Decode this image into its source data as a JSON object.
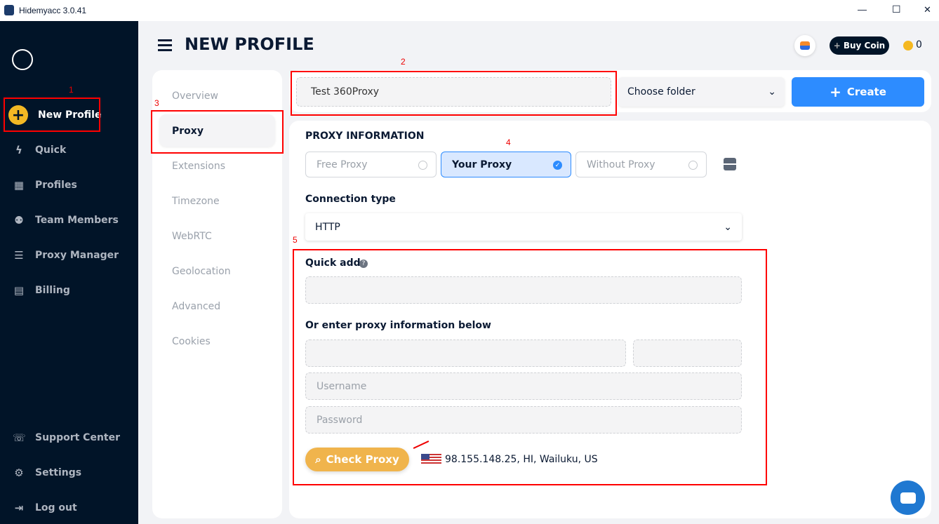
{
  "window": {
    "title": "Hidemyacc 3.0.41",
    "minimize": "—",
    "maximize": "☐",
    "close": "✕"
  },
  "sidebar": {
    "items": [
      {
        "label": "New Profile",
        "icon": "plus-circle-icon"
      },
      {
        "label": "Quick",
        "icon": "bolt-icon"
      },
      {
        "label": "Profiles",
        "icon": "grid-icon"
      },
      {
        "label": "Team Members",
        "icon": "team-icon"
      },
      {
        "label": "Proxy Manager",
        "icon": "server-icon"
      },
      {
        "label": "Billing",
        "icon": "receipt-icon"
      }
    ],
    "bottom": [
      {
        "label": "Support Center",
        "icon": "support-icon"
      },
      {
        "label": "Settings",
        "icon": "gear-icon"
      },
      {
        "label": "Log out",
        "icon": "logout-icon"
      }
    ]
  },
  "header": {
    "title": "NEW PROFILE",
    "buy_coin": "Buy Coin",
    "coin_count": "0"
  },
  "tabs": [
    "Overview",
    "Proxy",
    "Extensions",
    "Timezone",
    "WebRTC",
    "Geolocation",
    "Advanced",
    "Cookies"
  ],
  "profile": {
    "name": "Test 360Proxy",
    "folder": "Choose folder",
    "create": "Create"
  },
  "proxy": {
    "section_title": "PROXY INFORMATION",
    "options": [
      "Free Proxy",
      "Your Proxy",
      "Without Proxy"
    ],
    "selected": "Your Proxy",
    "connection_label": "Connection type",
    "connection_value": "HTTP",
    "quick_add": "Quick add",
    "quick_add_value": "",
    "manual_label": "Or enter proxy information below",
    "host": "",
    "port": "",
    "username_placeholder": "Username",
    "password_placeholder": "Password",
    "check_button": "Check Proxy",
    "result": "98.155.148.25, HI, Wailuku, US"
  },
  "annotations": [
    "1",
    "2",
    "3",
    "4",
    "5"
  ],
  "colors": {
    "sidebar": "#011428",
    "accent": "#2d8cff",
    "check": "#f0b44c",
    "new_profile": "#f3b824",
    "annotation": "#ff0000"
  }
}
